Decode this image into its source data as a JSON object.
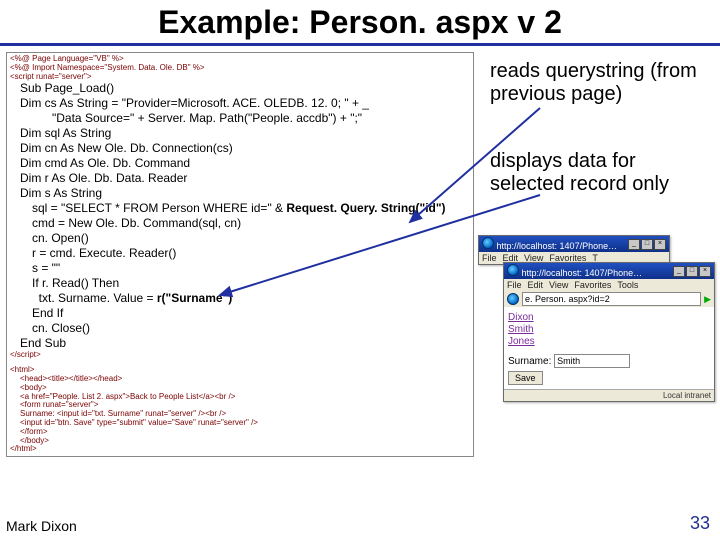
{
  "title": "Example: Person. aspx v 2",
  "annotations": {
    "a1": "reads querystring (from previous page)",
    "a2": "displays data for selected record only"
  },
  "code": {
    "l1": "<%@ Page Language=\"VB\" %>",
    "l2": "<%@ Import Namespace=\"System. Data. Ole. DB\" %>",
    "l3": "<script runat=\"server\">",
    "l4": "Sub Page_Load()",
    "l5": "Dim cs As String = \"Provider=Microsoft. ACE. OLEDB. 12. 0; \" + _",
    "l6": "\"Data Source=\" + Server. Map. Path(\"People. accdb\") + \";\"",
    "l7": "Dim sql  As String",
    "l8": "Dim cn   As New Ole. Db. Connection(cs)",
    "l9": "Dim cmd As Ole. Db. Command",
    "l10": "Dim r    As Ole. Db. Data. Reader",
    "l11": "Dim s    As String",
    "l12a": "sql = \"SELECT * FROM Person WHERE id=\" & ",
    "l12b": "Request. Query. String(\"id\")",
    "l13": "cmd = New Ole. Db. Command(sql, cn)",
    "l14": "cn. Open()",
    "l15": "r = cmd. Execute. Reader()",
    "l16": "s = \"\"",
    "l17": "If r. Read() Then",
    "l18a": "txt. Surname. Value = ",
    "l18b": "r(\"Surname\")",
    "l19": "End If",
    "l20": "cn. Close()",
    "l21": "End Sub",
    "l22": "</scr​ipt>",
    "l23": "<html>",
    "l24": "<head><title></title></head>",
    "l25": "<body>",
    "l26": "<a href=\"People. List 2. aspx\">Back to People List</a><br />",
    "l27": "<form runat=\"server\">",
    "l28": "Surname: <input id=\"txt. Surname\" runat=\"server\" /><br />",
    "l29": "<input id=\"btn. Save\" type=\"submit\" value=\"Save\" runat=\"server\" />",
    "l30": "</form>",
    "l31": "</body>",
    "l32": "</html>"
  },
  "browser1": {
    "title": "http://localhost: 1407/Phone…",
    "menu": [
      "File",
      "Edit",
      "View",
      "Favorites",
      "T"
    ]
  },
  "browser2": {
    "title": "http://localhost: 1407/Phone…",
    "menu": [
      "File",
      "Edit",
      "View",
      "Favorites",
      "Tools"
    ],
    "addr": "e. Person. aspx?id=2",
    "links": [
      "Dixon",
      "Smith",
      "Jones"
    ],
    "form_label": "Surname:",
    "form_value": "Smith",
    "btn": "Save",
    "status": "Local intranet"
  },
  "footer": {
    "left": "Mark Dixon",
    "right": "33"
  }
}
